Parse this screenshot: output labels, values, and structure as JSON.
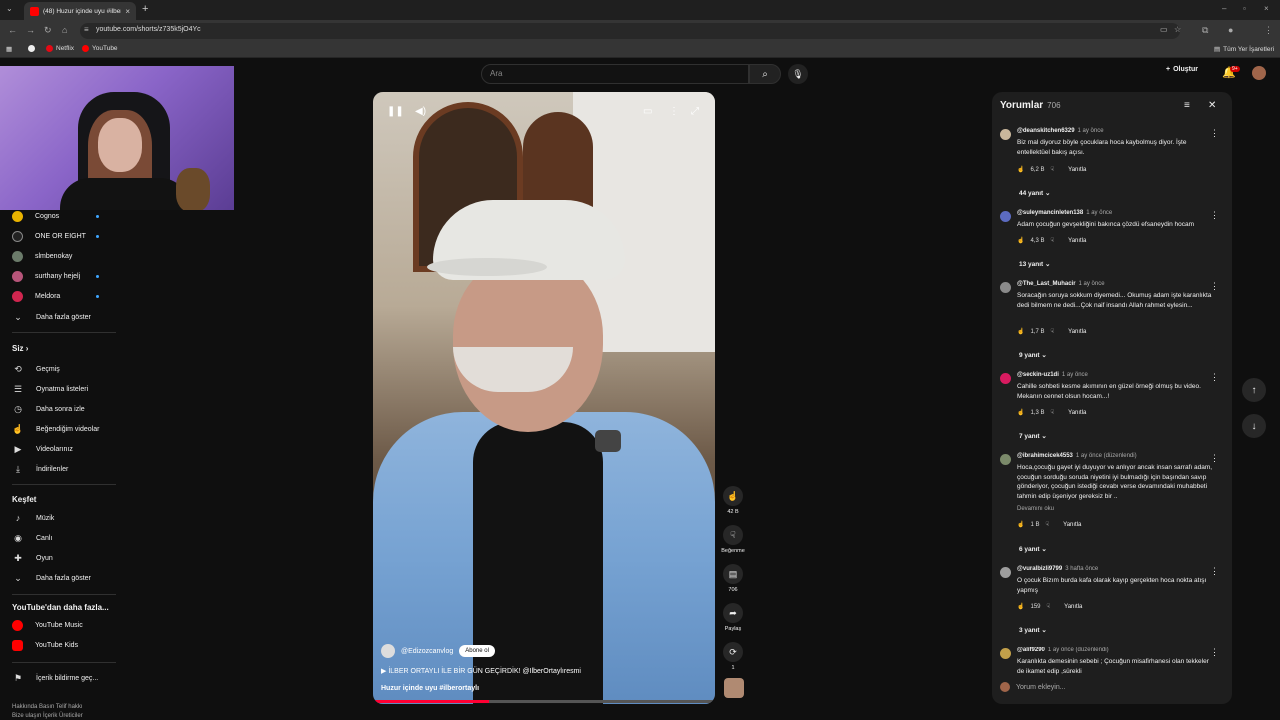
{
  "browser": {
    "tab_title": "(48) Huzur içinde uyu #ilber...",
    "url": "youtube.com/shorts/z735k5jO4Yc",
    "bookmarks": [
      {
        "label": "Netflix",
        "color": "#e50914"
      },
      {
        "label": "YouTube",
        "color": "#ff0000"
      }
    ],
    "all_bookmarks": "Tüm Yer İşaretleri"
  },
  "header": {
    "search_placeholder": "Ara",
    "create_label": "Oluştur",
    "notif_badge": "9+"
  },
  "sidebar": {
    "subscriptions": [
      {
        "label": "Cognos",
        "color": "#e9b300"
      },
      {
        "label": "ONE OR EIGHT",
        "color": "#222222"
      },
      {
        "label": "slmbenokay",
        "color": "#6b7b6a"
      },
      {
        "label": "surthany hejelj",
        "color": "#b7557a"
      },
      {
        "label": "Meldora",
        "color": "#d0264f"
      }
    ],
    "show_more": "Daha fazla göster",
    "you_heading": "Siz",
    "you_items": [
      {
        "label": "Geçmiş",
        "icon": "history-icon",
        "glyph": "⟲"
      },
      {
        "label": "Oynatma listeleri",
        "icon": "playlist-icon",
        "glyph": "☰"
      },
      {
        "label": "Daha sonra izle",
        "icon": "clock-icon",
        "glyph": "◷"
      },
      {
        "label": "Beğendiğim videolar",
        "icon": "thumbs-up-icon",
        "glyph": "👍"
      },
      {
        "label": "Videolarınız",
        "icon": "video-icon",
        "glyph": "▶"
      },
      {
        "label": "İndirilenler",
        "icon": "download-icon",
        "glyph": "⤓"
      }
    ],
    "explore_heading": "Keşfet",
    "explore_items": [
      {
        "label": "Müzik",
        "icon": "music-icon",
        "glyph": "♪"
      },
      {
        "label": "Canlı",
        "icon": "live-icon",
        "glyph": "◉"
      },
      {
        "label": "Oyun",
        "icon": "gamepad-icon",
        "glyph": "🎮"
      }
    ],
    "show_more2": "Daha fazla göster",
    "more_heading": "YouTube'dan daha fazla...",
    "more_items": [
      {
        "label": "YouTube Music"
      },
      {
        "label": "YouTube Kids"
      }
    ],
    "report_history": "İçerik bildirme geç...",
    "footer_line1": "Hakkında  Basın  Telif hakkı",
    "footer_line2": "Bize ulaşın  İçerik Üreticiler"
  },
  "video": {
    "channel": "@Edizozcanvlog",
    "subscribe": "Abone ol",
    "link_text": "▶ İLBER ORTAYLI İLE BİR GÜN GEÇİRDİK! @IlberOrtaylıresmi",
    "title": "Huzur içinde uyu #ilberortaylı",
    "progress_fraction": 0.34
  },
  "actions": {
    "likes": "42 B",
    "dislike": "Beğenme",
    "comments": "706",
    "share": "Paylaş",
    "remix": "1"
  },
  "comments_panel": {
    "title": "Yorumlar",
    "count": "706",
    "add_placeholder": "Yorum ekleyin...",
    "reply_label": "Yanıtla",
    "comments": [
      {
        "user": "@deanskitchen6329",
        "time": "1 ay önce",
        "text": "Biz mal diyoruz böyle çocuklara hoca kaybolmuş diyor. İşte entellektüel bakış açısı.",
        "likes": "6,2 B",
        "replies": "44 yanıt",
        "color": "#c9b79c"
      },
      {
        "user": "@suleymancinleten138",
        "time": "1 ay önce",
        "text": "Adam çocuğun gevşekliğini bakınca çözdü efsaneydin hocam",
        "likes": "4,3 B",
        "replies": "13 yanıt",
        "color": "#5c6bc0"
      },
      {
        "user": "@The_Last_Muhacir",
        "time": "1 ay önce",
        "text": "Soracağın soruya sokkum diyemedi... Okumuş adam işte karanlıkta dedi bilmem ne dedi...Çok naif insandı Allah rahmet eylesin...",
        "likes": "1,7 B",
        "replies": "9 yanıt",
        "color": "#8a8a8a"
      },
      {
        "user": "@seckin-uz1di",
        "time": "1 ay önce",
        "text": "Cahille sohbeti kesme akımının en güzel örneği olmuş bu video. Mekanın cennet olsun hocam...!",
        "likes": "1,3 B",
        "replies": "7 yanıt",
        "color": "#d81b60"
      },
      {
        "user": "@ibrahimcicek4553",
        "time": "1 ay önce (düzenlendi)",
        "text": "Hoca,çocuğu gayet iyi duyuyor ve anlıyor ancak insan sarrafı adam, çocuğun sorduğu soruda niyetini iyi bulmadığı için başından savıp gönderiyor, çocuğun istediği cevabı verse devamındaki muhabbeti tahmin edip üşeniyor gereksiz bir ..",
        "more": "Devamını oku",
        "likes": "1 B",
        "replies": "6 yanıt",
        "color": "#7b8a6a"
      },
      {
        "user": "@vuralbizli9799",
        "time": "3 hafta önce",
        "text": "O çocuk Bizım burda kafa olarak kayıp gerçekten hoca nokta atışı yapmış",
        "likes": "159",
        "replies": "3 yanıt",
        "color": "#9e9e9e"
      },
      {
        "user": "@alif9290",
        "time": "1 ay önce (düzenlendi)",
        "text": "Karanlıkta demesinin sebebi ; Çocuğun misafirhanesi olan tekkeler de ikamet edip ,sürekli",
        "likes": "",
        "replies": "",
        "color": "#c2a04a"
      }
    ]
  }
}
